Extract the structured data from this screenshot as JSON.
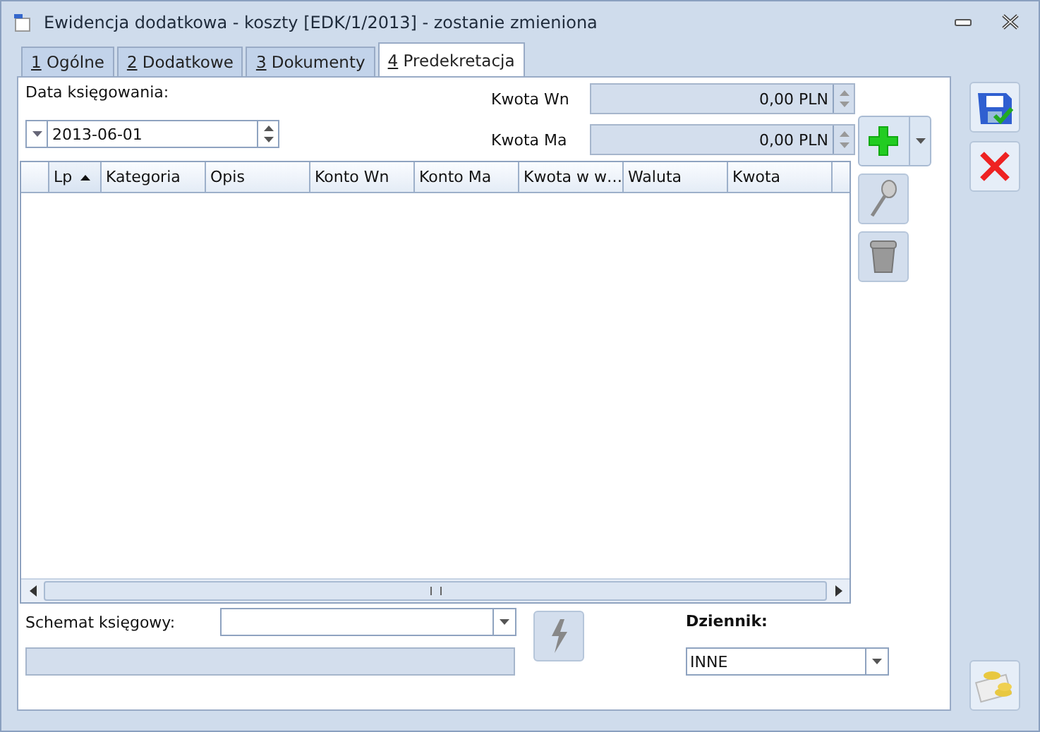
{
  "window": {
    "title": "Ewidencja dodatkowa - koszty [EDK/1/2013] - zostanie zmieniona"
  },
  "tabs": [
    {
      "key": "1",
      "label": "Ogólne",
      "selected": false
    },
    {
      "key": "2",
      "label": "Dodatkowe",
      "selected": false
    },
    {
      "key": "3",
      "label": "Dokumenty",
      "selected": false
    },
    {
      "key": "4",
      "label": "Predekretacja",
      "selected": true
    }
  ],
  "date": {
    "label": "Data księgowania:",
    "value": "2013-06-01"
  },
  "kwota_wn": {
    "label": "Kwota Wn",
    "value": "0,00 PLN"
  },
  "kwota_ma": {
    "label": "Kwota Ma",
    "value": "0,00 PLN"
  },
  "table": {
    "columns": [
      {
        "label": "Lp",
        "sorted": true
      },
      {
        "label": "Kategoria",
        "sorted": false
      },
      {
        "label": "Opis",
        "sorted": false
      },
      {
        "label": "Konto Wn",
        "sorted": false
      },
      {
        "label": "Konto Ma",
        "sorted": false
      },
      {
        "label": "Kwota w w…",
        "sorted": false
      },
      {
        "label": "Waluta",
        "sorted": false
      },
      {
        "label": "Kwota",
        "sorted": false
      }
    ]
  },
  "schemat": {
    "label": "Schemat księgowy:"
  },
  "dziennik": {
    "label": "Dziennik:",
    "value": "INNE"
  }
}
